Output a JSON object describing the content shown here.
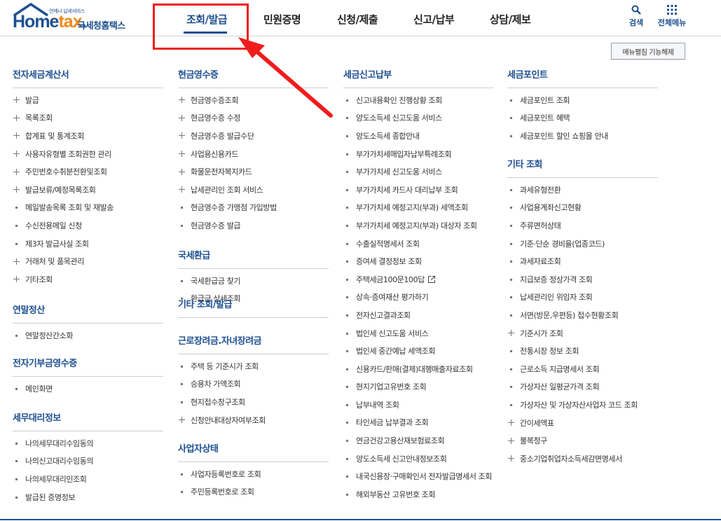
{
  "logo": {
    "tagline": "언제나 납세서비스",
    "brand_prefix": "Home",
    "brand_x": "tax",
    "brand_dot": ".",
    "korean": "국세청홈택스"
  },
  "nav": [
    {
      "label": "조회/발급",
      "active": true
    },
    {
      "label": "민원증명"
    },
    {
      "label": "신청/제출"
    },
    {
      "label": "신고/납부"
    },
    {
      "label": "상담/제보"
    }
  ],
  "util": {
    "search": "검색",
    "allmenu": "전체메뉴"
  },
  "toggle_button": "메뉴펼침 기능해제",
  "columns": [
    [
      {
        "title": "전자세금계산서",
        "items": [
          {
            "label": "발급",
            "marker": "plus"
          },
          {
            "label": "목록조회",
            "marker": "plus"
          },
          {
            "label": "합계표 및 통계조회",
            "marker": "plus"
          },
          {
            "label": "사용자유형별 조회권한 관리",
            "marker": "plus"
          },
          {
            "label": "주민번호수취분전환및조회",
            "marker": "plus"
          },
          {
            "label": "발급보류/예정목록조회",
            "marker": "plus"
          },
          {
            "label": "메일발송목록 조회 및 재발송",
            "marker": "bullet"
          },
          {
            "label": "수신전용메일 신청",
            "marker": "bullet"
          },
          {
            "label": "제3자 발급사실 조회",
            "marker": "bullet"
          },
          {
            "label": "거래처 및 품목관리",
            "marker": "plus"
          },
          {
            "label": "기타조회",
            "marker": "plus"
          }
        ]
      },
      {
        "title": "연말정산",
        "items": [
          {
            "label": "연말정산간소화",
            "marker": "bullet"
          }
        ]
      },
      {
        "title": "전자기부금영수증",
        "items": [
          {
            "label": "메인화면",
            "marker": "bullet"
          }
        ]
      },
      {
        "title": "세무대리정보",
        "items": [
          {
            "label": "나의세무대리수임동의",
            "marker": "bullet"
          },
          {
            "label": "나의신고대리수임동의",
            "marker": "bullet"
          },
          {
            "label": "나의세무대리인조회",
            "marker": "bullet"
          },
          {
            "label": "발급된 증명정보",
            "marker": "bullet"
          }
        ]
      }
    ],
    [
      {
        "title": "현금영수증",
        "items": [
          {
            "label": "현금영수증조회",
            "marker": "plus"
          },
          {
            "label": "현금영수증 수정",
            "marker": "plus"
          },
          {
            "label": "현금영수증 발급수단",
            "marker": "plus"
          },
          {
            "label": "사업용신용카드",
            "marker": "plus"
          },
          {
            "label": "화물운전자복지카드",
            "marker": "plus"
          },
          {
            "label": "납세관리인 조회 서비스",
            "marker": "plus"
          },
          {
            "label": "현금영수증 가맹점 가입방법",
            "marker": "bullet"
          },
          {
            "label": "현금영수증 발급",
            "marker": "bullet"
          }
        ]
      },
      {
        "title": "국세환급",
        "items": [
          {
            "label": "국세환급금 찾기",
            "marker": "bullet"
          },
          {
            "label": "환급금 상세조회",
            "marker": "bullet"
          }
        ]
      },
      {
        "title": "기타 조회/발급",
        "items": []
      },
      {
        "title": "근로장려금.자녀장려금",
        "items": [
          {
            "label": "주택 등 기준시가 조회",
            "marker": "bullet"
          },
          {
            "label": "승용차 가액조회",
            "marker": "bullet"
          },
          {
            "label": "현지접수창구조회",
            "marker": "bullet"
          },
          {
            "label": "신청안내대상자여부조회",
            "marker": "plus"
          }
        ]
      },
      {
        "title": "사업자상태",
        "items": [
          {
            "label": "사업자등록번호로 조회",
            "marker": "bullet"
          },
          {
            "label": "주민등록번호로 조회",
            "marker": "bullet"
          }
        ]
      }
    ],
    [
      {
        "title": "세금신고납부",
        "items": [
          {
            "label": "신고내용확인 진행상황 조회",
            "marker": "bullet"
          },
          {
            "label": "양도소득세 신고도움 서비스",
            "marker": "bullet"
          },
          {
            "label": "양도소득세 종합안내",
            "marker": "bullet"
          },
          {
            "label": "부가가치세매입자납부특례조회",
            "marker": "bullet"
          },
          {
            "label": "부가가치세 신고도움 서비스",
            "marker": "bullet"
          },
          {
            "label": "부가가치세 카드사 대리납부 조회",
            "marker": "bullet"
          },
          {
            "label": "부가가치세 예정고지(부과) 세액조회",
            "marker": "bullet"
          },
          {
            "label": "부가가치세 예정고지(부과) 대상자 조회",
            "marker": "bullet"
          },
          {
            "label": "수출실적명세서 조회",
            "marker": "bullet"
          },
          {
            "label": "증여세 결정정보 조회",
            "marker": "bullet"
          },
          {
            "label": "주택세금100문100답",
            "marker": "bullet",
            "external": true
          },
          {
            "label": "상속·증여재산 평가하기",
            "marker": "bullet"
          },
          {
            "label": "전자신고결과조회",
            "marker": "bullet"
          },
          {
            "label": "법인세 신고도움 서비스",
            "marker": "bullet"
          },
          {
            "label": "법인세 중간예납 세액조회",
            "marker": "bullet"
          },
          {
            "label": "신용카드/판매(결제)대행매출자료조회",
            "marker": "bullet"
          },
          {
            "label": "현지기업고유번호 조회",
            "marker": "bullet"
          },
          {
            "label": "납부내역 조회",
            "marker": "bullet"
          },
          {
            "label": "타인세금 납부결과 조회",
            "marker": "bullet"
          },
          {
            "label": "연금건강고용산재보험료조회",
            "marker": "bullet"
          },
          {
            "label": "양도소득세 신고안내정보조회",
            "marker": "bullet"
          },
          {
            "label": "내국신용장·구매확인서 전자발급명세서 조회",
            "marker": "bullet"
          },
          {
            "label": "해외부동산 고유번호 조회",
            "marker": "bullet"
          }
        ]
      }
    ],
    [
      {
        "title": "세금포인트",
        "items": [
          {
            "label": "세금포인트 조회",
            "marker": "bullet"
          },
          {
            "label": "세금포인트 혜택",
            "marker": "bullet"
          },
          {
            "label": "세금포인트 할인 쇼핑몰 안내",
            "marker": "bullet"
          }
        ]
      },
      {
        "title": "기타 조회",
        "items": [
          {
            "label": "과세유형전환",
            "marker": "bullet"
          },
          {
            "label": "사업용계좌신고현황",
            "marker": "bullet"
          },
          {
            "label": "주류면허상태",
            "marker": "bullet"
          },
          {
            "label": "기준·단순 경비율(업종코드)",
            "marker": "bullet"
          },
          {
            "label": "과세자료조회",
            "marker": "bullet"
          },
          {
            "label": "지급보증 정상가격 조회",
            "marker": "bullet"
          },
          {
            "label": "납세관리인 위임자 조회",
            "marker": "bullet"
          },
          {
            "label": "서면(방문,우편등) 접수현황조회",
            "marker": "bullet"
          },
          {
            "label": "기준시가 조회",
            "marker": "plus"
          },
          {
            "label": "전통시장 정보 조회",
            "marker": "bullet"
          },
          {
            "label": "근로소득 지급명세서 조회",
            "marker": "bullet"
          },
          {
            "label": "가상자산 일평균가격 조회",
            "marker": "bullet"
          },
          {
            "label": "가상자산 및 가상자산사업자 코드 조회",
            "marker": "bullet"
          },
          {
            "label": "간이세액표",
            "marker": "plus"
          },
          {
            "label": "불복청구",
            "marker": "plus"
          },
          {
            "label": "중소기업취업자소득세감면명세서",
            "marker": "plus"
          }
        ]
      }
    ]
  ]
}
